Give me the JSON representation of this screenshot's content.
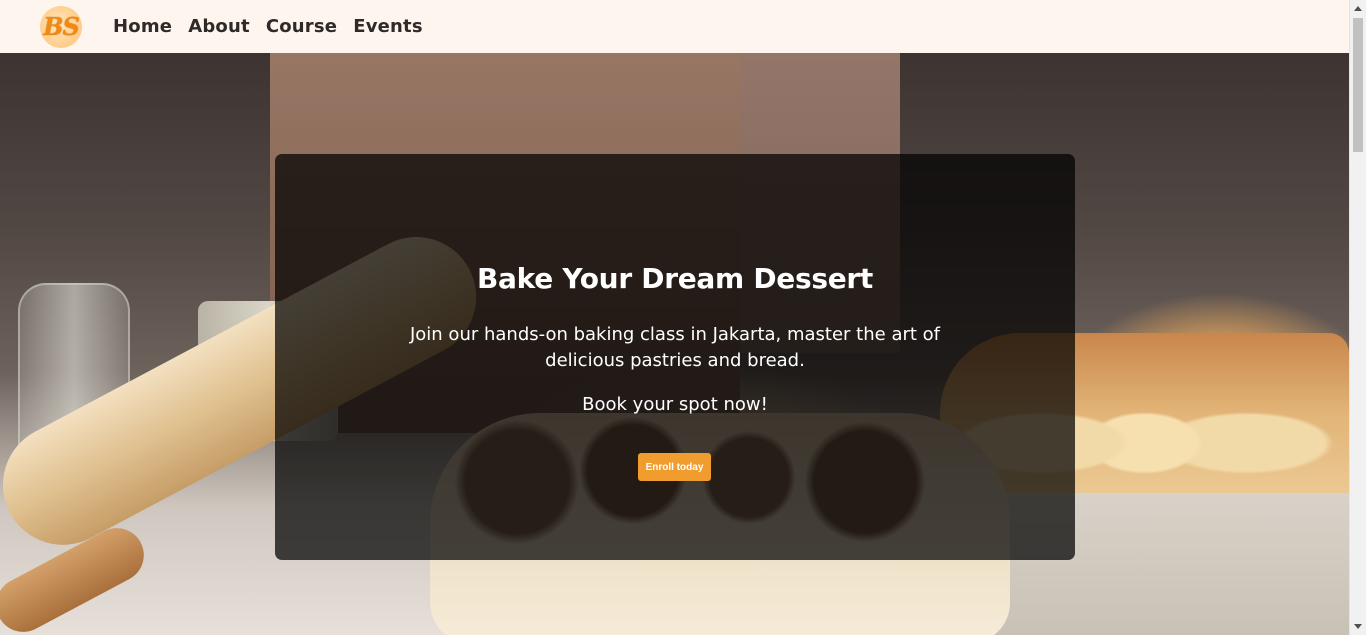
{
  "brand": {
    "logo_text": "BS"
  },
  "nav": {
    "links": [
      "Home",
      "About",
      "Course",
      "Events"
    ]
  },
  "hero": {
    "title": "Bake Your Dream Dessert",
    "description": "Join our hands-on baking class in Jakarta, master the art of delicious pastries and bread.",
    "cta_text": "Book your spot now!",
    "button_label": "Enroll today"
  },
  "colors": {
    "navbar_bg": "#fff5ef",
    "accent": "#f09c2f",
    "logo_text": "#f08a12"
  }
}
